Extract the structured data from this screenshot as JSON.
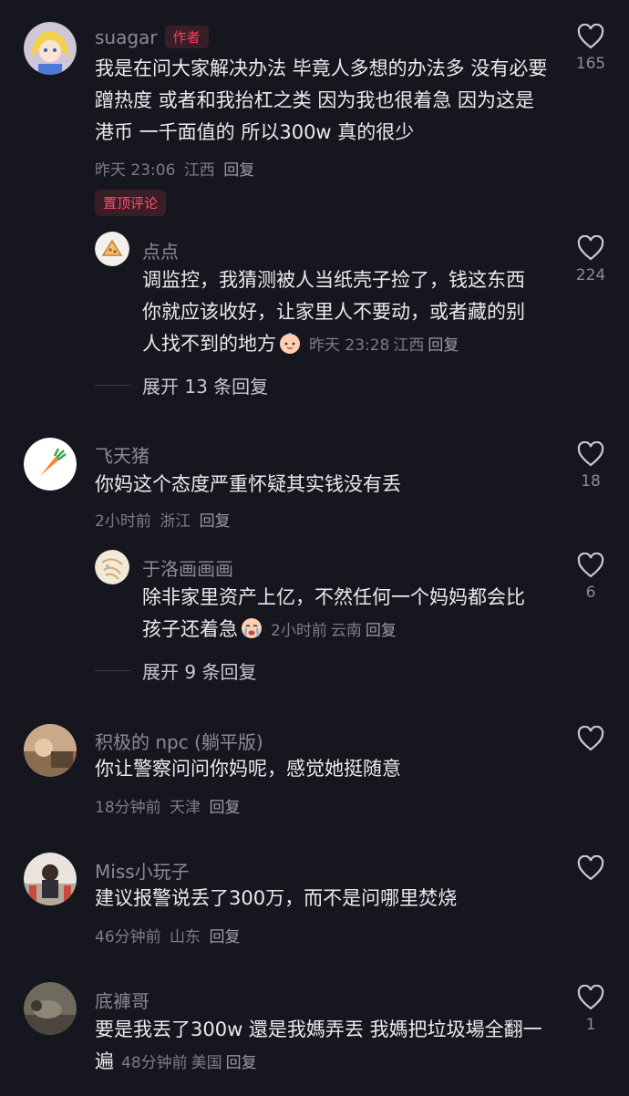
{
  "comments": [
    {
      "name": "suagar",
      "badge": "作者",
      "text": "我是在问大家解决办法 毕竟人多想的办法多 没有必要蹭热度 或者和我抬杠之类 因为我也很着急 因为这是港币 一千面值的 所以300w 真的很少",
      "time": "昨天 23:06",
      "location": "江西",
      "reply": "回复",
      "likes": "165"
    },
    {
      "pinned": "置顶评论",
      "name": "点点",
      "text": "调监控，我猜测被人当纸壳子捡了，钱这东西你就应该收好，让家里人不要动，或者藏的别人找不到的地方",
      "time": "昨天 23:28",
      "location": "江西",
      "reply": "回复",
      "likes": "224",
      "expand": "展开 13 条回复"
    },
    {
      "name": "飞天猪",
      "text": "你妈这个态度严重怀疑其实钱没有丢",
      "time": "2小时前",
      "location": "浙江",
      "reply": "回复",
      "likes": "18"
    },
    {
      "name": "于洛画画画",
      "text": "除非家里资产上亿，不然任何一个妈妈都会比孩子还着急",
      "time": "2小时前",
      "location": "云南",
      "reply": "回复",
      "likes": "6",
      "expand": "展开 9 条回复"
    },
    {
      "name": "积极的 npc (躺平版)",
      "text": "你让警察问问你妈呢，感觉她挺随意",
      "time": "18分钟前",
      "location": "天津",
      "reply": "回复",
      "likes": ""
    },
    {
      "name": "Miss小玩子",
      "text": "建议报警说丢了300万，而不是问哪里焚烧",
      "time": "46分钟前",
      "location": "山东",
      "reply": "回复",
      "likes": ""
    },
    {
      "name": "底褲哥",
      "text": "要是我丟了300w 還是我媽弄丟 我媽把垃圾場全翻一遍",
      "time": "48分钟前",
      "location": "美国",
      "reply": "回复",
      "likes": "1"
    }
  ],
  "icons": {
    "like": "heart-outline-icon",
    "emoji_baby": "baby-face-emoji",
    "emoji_cry": "crying-face-emoji"
  },
  "colors": {
    "background": "#16161e",
    "accent": "#ff3b5c"
  }
}
